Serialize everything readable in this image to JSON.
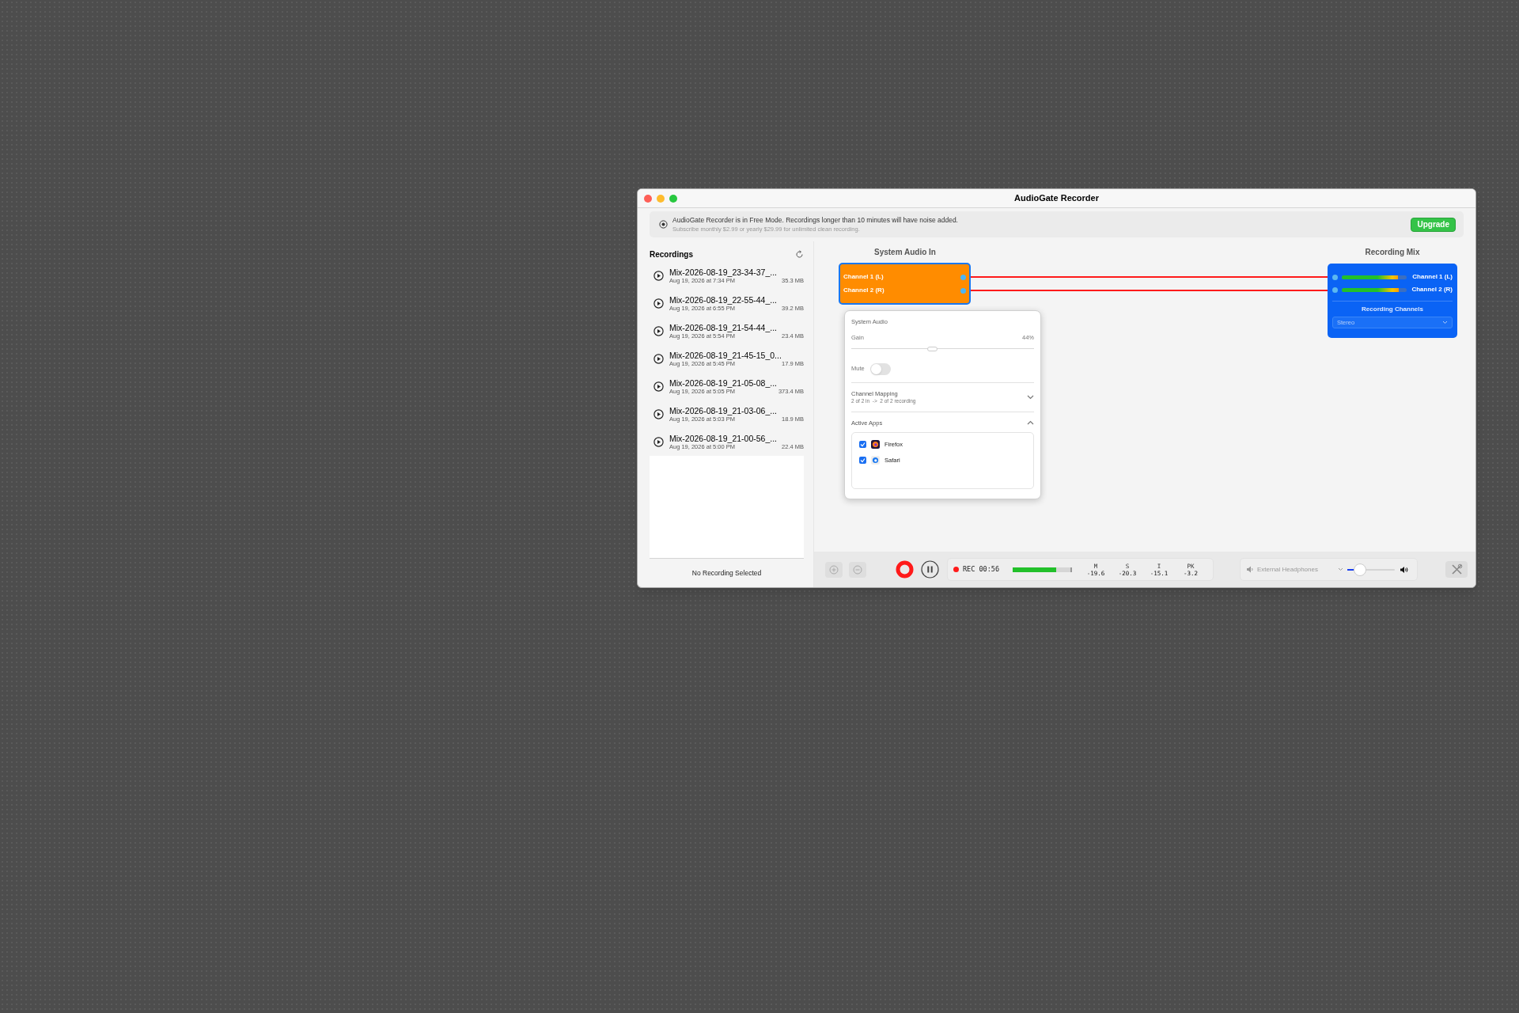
{
  "window": {
    "title": "AudioGate Recorder"
  },
  "banner": {
    "message": "AudioGate Recorder is in Free Mode. Recordings longer than 10 minutes will have noise added.",
    "detail": "Subscribe monthly $2.99 or yearly $29.99 for unlimited clean recording.",
    "button": "Upgrade"
  },
  "sidebar": {
    "title": "Recordings",
    "items": [
      {
        "name": "Mix-2026-08-19_23-34-37_...",
        "date": "Aug 19, 2026 at 7:34 PM",
        "size": "35.3 MB"
      },
      {
        "name": "Mix-2026-08-19_22-55-44_...",
        "date": "Aug 19, 2026 at 6:55 PM",
        "size": "39.2 MB"
      },
      {
        "name": "Mix-2026-08-19_21-54-44_...",
        "date": "Aug 19, 2026 at 5:54 PM",
        "size": "23.4 MB"
      },
      {
        "name": "Mix-2026-08-19_21-45-15_0...",
        "date": "Aug 19, 2026 at 5:45 PM",
        "size": "17.9 MB"
      },
      {
        "name": "Mix-2026-08-19_21-05-08_...",
        "date": "Aug 19, 2026 at 5:05 PM",
        "size": "373.4 MB"
      },
      {
        "name": "Mix-2026-08-19_21-03-06_...",
        "date": "Aug 19, 2026 at 5:03 PM",
        "size": "18.9 MB"
      },
      {
        "name": "Mix-2026-08-19_21-00-56_...",
        "date": "Aug 19, 2026 at 5:00 PM",
        "size": "22.4 MB"
      }
    ],
    "footer": "No Recording Selected"
  },
  "source": {
    "title": "System Audio In",
    "channels": [
      "Channel 1 (L)",
      "Channel 2 (R)"
    ]
  },
  "popover": {
    "title": "System Audio",
    "gain": {
      "label": "Gain",
      "reading": "44%",
      "level": 0.44
    },
    "mute": {
      "label": "Mute",
      "on": false
    },
    "sections": [
      {
        "title": "Channel Mapping",
        "subtitle": "2 of 2 in  ->  2 of 2 recording",
        "expanded": false
      },
      {
        "title": "Active Apps",
        "expanded": true,
        "apps": [
          {
            "name": "Firefox",
            "checked": true
          },
          {
            "name": "Safari",
            "checked": true
          }
        ]
      }
    ]
  },
  "mix": {
    "title": "Recording Mix",
    "channels": [
      {
        "name": "Channel 1 (L)",
        "level": 0.86
      },
      {
        "name": "Channel 2 (R)",
        "level": 0.88
      }
    ],
    "channels_label": "Recording Channels",
    "channels_value": "Stereo"
  },
  "transport": {
    "status": "REC 00:56",
    "level": 0.75,
    "readings": [
      {
        "label": "M",
        "value": "-19.6"
      },
      {
        "label": "S",
        "value": "-20.3"
      },
      {
        "label": "I",
        "value": "-15.1"
      },
      {
        "label": "PK",
        "value": "-3.2"
      }
    ],
    "output": {
      "device": "External Headphones",
      "level": 0.18
    }
  }
}
